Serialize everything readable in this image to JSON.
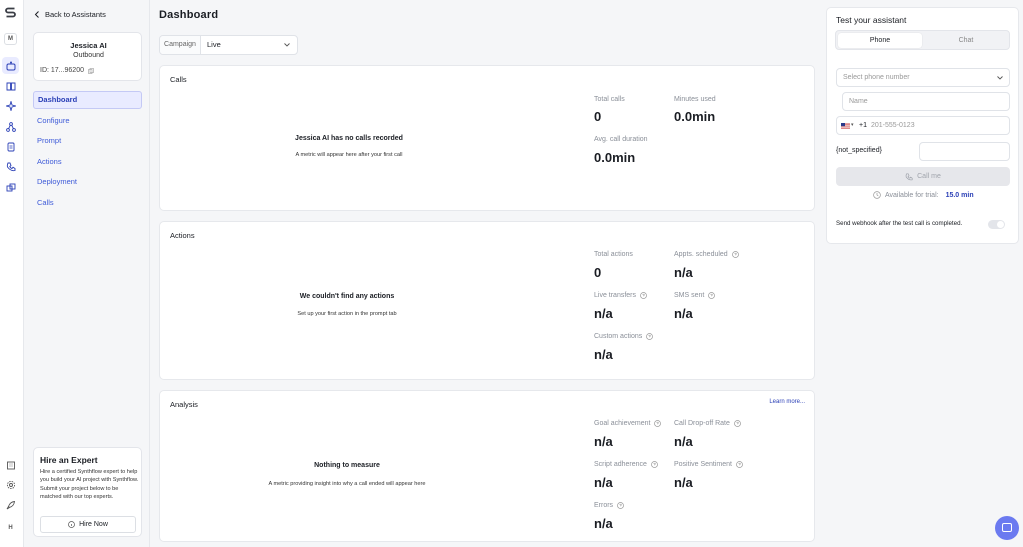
{
  "nav_rail": {
    "logo": "synthflow-logo",
    "workspace_initial": "M",
    "user_initial": "H",
    "icons": [
      "assistants-icon",
      "book-icon",
      "sparkle-icon",
      "integrations-icon",
      "document-icon",
      "phone-icon",
      "puzzle-icon"
    ],
    "bottom_icons": [
      "building-icon",
      "settings-icon",
      "rocket-icon"
    ]
  },
  "sidebar": {
    "back_label": "Back to Assistants",
    "agent": {
      "name": "Jessica AI",
      "type": "Outbound",
      "id": "ID: 17...96200"
    },
    "items": [
      {
        "label": "Dashboard",
        "active": true
      },
      {
        "label": "Configure",
        "active": false
      },
      {
        "label": "Prompt",
        "active": false
      },
      {
        "label": "Actions",
        "active": false
      },
      {
        "label": "Deployment",
        "active": false
      },
      {
        "label": "Calls",
        "active": false
      }
    ],
    "hire": {
      "title": "Hire an Expert",
      "text": "Hire a certified Synthflow expert to help you build your AI project with Synthflow. Submit your project below to be matched with our top experts.",
      "button": "Hire Now"
    }
  },
  "main": {
    "title": "Dashboard",
    "campaign": {
      "label": "Campaign",
      "value": "Live"
    },
    "calls": {
      "title": "Calls",
      "empty_title": "Jessica AI has no calls recorded",
      "empty_sub": "A metric will appear here after your first call",
      "metrics": [
        {
          "label": "Total calls",
          "value": "0"
        },
        {
          "label": "Minutes used",
          "value": "0.0min"
        },
        {
          "label": "Avg. call duration",
          "value": "0.0min"
        }
      ]
    },
    "actions": {
      "title": "Actions",
      "empty_title": "We couldn't find any actions",
      "empty_sub": "Set up your first action in the prompt tab",
      "metrics": [
        {
          "label": "Total actions",
          "value": "0"
        },
        {
          "label": "Appts. scheduled",
          "value": "n/a"
        },
        {
          "label": "Live transfers",
          "value": "n/a"
        },
        {
          "label": "SMS sent",
          "value": "n/a"
        },
        {
          "label": "Custom actions",
          "value": "n/a"
        }
      ]
    },
    "analysis": {
      "title": "Analysis",
      "learn_more": "Learn more...",
      "empty_title": "Nothing to measure",
      "empty_sub": "A metric providing insight into why a call ended will appear here",
      "metrics": [
        {
          "label": "Goal achievement",
          "value": "n/a"
        },
        {
          "label": "Call Drop-off Rate",
          "value": "n/a"
        },
        {
          "label": "Script adherence",
          "value": "n/a"
        },
        {
          "label": "Positive Sentiment",
          "value": "n/a"
        },
        {
          "label": "Errors",
          "value": "n/a"
        }
      ]
    }
  },
  "test_panel": {
    "title": "Test your assistant",
    "tabs": [
      {
        "label": "Phone",
        "active": true
      },
      {
        "label": "Chat",
        "active": false
      }
    ],
    "select_placeholder": "Select phone number",
    "name_placeholder": "Name",
    "phone_code": "+1",
    "phone_placeholder": "201-555-0123",
    "not_specified": "{not_specified}",
    "call_button": "Call me",
    "trial_label": "Available for trial:",
    "trial_value": "15.0 min",
    "webhook_text": "Send webhook after the test call is completed."
  },
  "colors": {
    "accent": "#2a3fb6",
    "active_bg": "#e9ebff",
    "fab": "#6b7af0"
  }
}
